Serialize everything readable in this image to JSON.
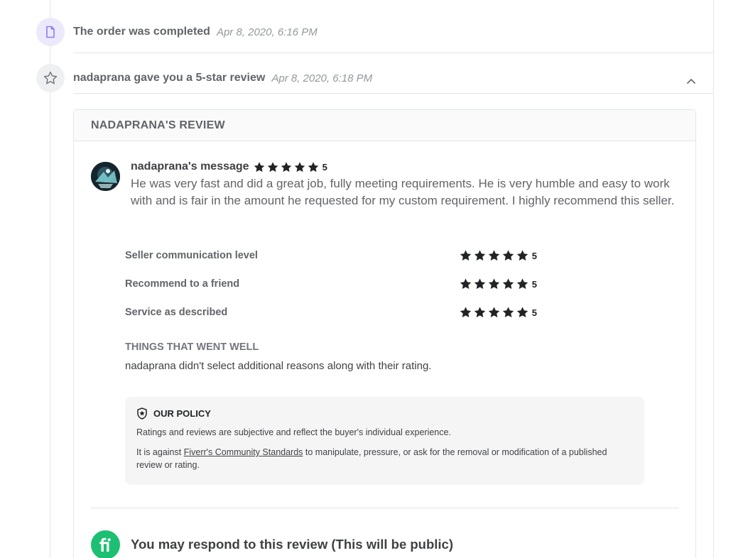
{
  "events": [
    {
      "title": "The order was completed",
      "time": "Apr 8, 2020, 6:16 PM",
      "icon": "document-icon"
    },
    {
      "title": "nadaprana gave you a 5-star review",
      "time": "Apr 8, 2020, 6:18 PM",
      "icon": "star-outline-icon"
    }
  ],
  "review": {
    "header": "NADAPRANA'S REVIEW",
    "author_label": "nadaprana's message",
    "overall_score": "5",
    "message": "He was very fast and did a great job, fully meeting requirements. He is very humble and easy to work with and is fair in the amount he requested for my custom requirement. I highly recommend this seller.",
    "ratings": [
      {
        "label": "Seller communication level",
        "score": "5"
      },
      {
        "label": "Recommend to a friend",
        "score": "5"
      },
      {
        "label": "Service as described",
        "score": "5"
      }
    ],
    "went_well": {
      "title": "THINGS THAT WENT WELL",
      "text": "nadaprana didn't select additional reasons along with their rating."
    },
    "policy": {
      "title": "OUR POLICY",
      "p1": "Ratings and reviews are subjective and reflect the buyer's individual experience.",
      "p2_before": "It is against ",
      "p2_link": "Fiverr's Community Standards",
      "p2_after": " to manipulate, pressure, or ask for the removal or modification of a published review or rating."
    },
    "respond": {
      "title": "You may respond to this review (This will be public)"
    }
  },
  "colors": {
    "brand_green": "#1dbf73",
    "star": "#222325",
    "text_dark": "#404145",
    "text_muted": "#62646a"
  }
}
